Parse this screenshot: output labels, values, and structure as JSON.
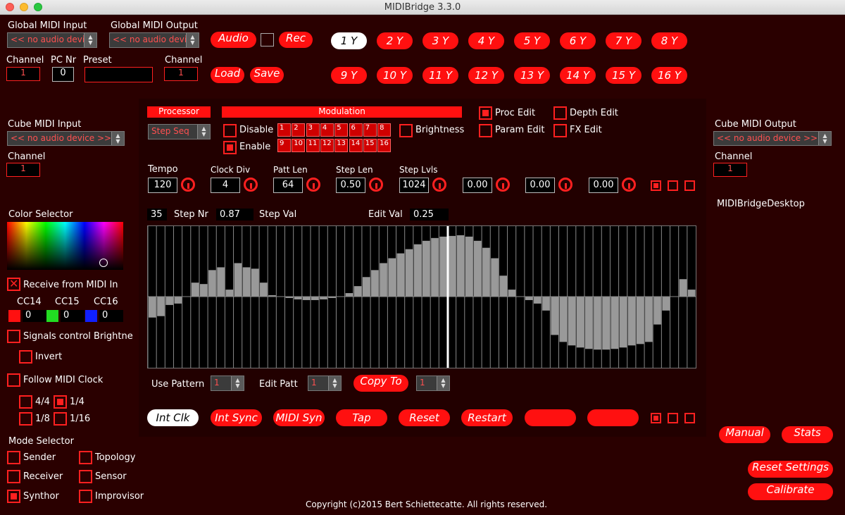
{
  "window": {
    "title": "MIDIBridge 3.3.0"
  },
  "global": {
    "midi_input_label": "Global MIDI Input",
    "midi_input_value": "<< no audio devic...",
    "midi_output_label": "Global MIDI Output",
    "midi_output_value": "<< no audio devic...",
    "channel_label": "Channel",
    "channel_value": "1",
    "pc_label": "PC Nr",
    "pc_value": "0",
    "preset_label": "Preset",
    "preset_value": "",
    "out_channel_label": "Channel",
    "out_channel_value": "1"
  },
  "top_buttons": {
    "audio": "Audio",
    "rec": "Rec",
    "load": "Load",
    "save": "Save"
  },
  "patterns": [
    "1 Y",
    "2 Y",
    "3 Y",
    "4 Y",
    "5 Y",
    "6 Y",
    "7 Y",
    "8 Y",
    "9 Y",
    "10 Y",
    "11 Y",
    "12 Y",
    "13 Y",
    "14 Y",
    "15 Y",
    "16 Y"
  ],
  "cube_in": {
    "label": "Cube MIDI Input",
    "value": "<< no audio device >>",
    "channel_label": "Channel",
    "channel_value": "1"
  },
  "cube_out": {
    "label": "Cube MIDI Output",
    "value": "<< no audio device >>",
    "channel_label": "Channel",
    "channel_value": "1",
    "desktop": "MIDIBridgeDesktop"
  },
  "processor": {
    "label": "Processor",
    "value": "Step Seq"
  },
  "modulation": {
    "label": "Modulation",
    "disable": "Disable",
    "enable": "Enable",
    "brightness": "Brightness",
    "row1": [
      "1",
      "2",
      "3",
      "4",
      "5",
      "6",
      "7",
      "8"
    ],
    "row2": [
      "9",
      "10",
      "11",
      "12",
      "13",
      "14",
      "15",
      "16"
    ]
  },
  "edit": {
    "proc": "Proc Edit",
    "param": "Param Edit",
    "depth": "Depth Edit",
    "fx": "FX Edit"
  },
  "params": [
    {
      "label": "Tempo",
      "value": "120"
    },
    {
      "label": "Clock Div",
      "value": "4"
    },
    {
      "label": "Patt Len",
      "value": "64"
    },
    {
      "label": "Step Len",
      "value": "0.50"
    },
    {
      "label": "Step Lvls",
      "value": "1024"
    },
    {
      "label": "",
      "value": "0.00"
    },
    {
      "label": "",
      "value": "0.00"
    },
    {
      "label": "",
      "value": "0.00"
    }
  ],
  "step_info": {
    "step_nr": "35",
    "step_nr_label": "Step Nr",
    "step_val": "0.87",
    "step_val_label": "Step Val",
    "edit_val_label": "Edit Val",
    "edit_val": "0.25"
  },
  "chart_data": {
    "type": "bar",
    "selected_index": 35,
    "ylim": [
      -1,
      1
    ],
    "values": [
      -0.3,
      -0.28,
      -0.12,
      -0.1,
      0,
      0.2,
      0.18,
      0.38,
      0.42,
      0.1,
      0.48,
      0.42,
      0.4,
      0.2,
      0.02,
      0,
      -0.02,
      -0.04,
      -0.05,
      -0.05,
      -0.04,
      -0.02,
      0,
      0.05,
      0.15,
      0.28,
      0.38,
      0.48,
      0.55,
      0.62,
      0.68,
      0.75,
      0.8,
      0.84,
      0.86,
      0.87,
      0.88,
      0.86,
      0.8,
      0.7,
      0.55,
      0.3,
      0.1,
      0,
      -0.05,
      -0.1,
      -0.2,
      -0.55,
      -0.65,
      -0.7,
      -0.73,
      -0.75,
      -0.76,
      -0.76,
      -0.75,
      -0.73,
      -0.7,
      -0.68,
      -0.65,
      -0.4,
      -0.2,
      0,
      0.25,
      0.1
    ]
  },
  "pattern_ctrl": {
    "use_label": "Use Pattern",
    "use_value": "1",
    "edit_label": "Edit Patt",
    "edit_value": "1",
    "copy_label": "Copy To",
    "copy_value": "1"
  },
  "clock_buttons": [
    "Int Clk",
    "Int Sync",
    "MIDI Syn",
    "Tap",
    "Reset",
    "Restart",
    "",
    ""
  ],
  "color": {
    "label": "Color Selector",
    "receive": "Receive from MIDI In",
    "cc": [
      {
        "label": "CC14",
        "value": "0",
        "color": "#ff1010"
      },
      {
        "label": "CC15",
        "value": "0",
        "color": "#22dd22"
      },
      {
        "label": "CC16",
        "value": "0",
        "color": "#1020ff"
      }
    ],
    "signals": "Signals control Brightne",
    "invert": "Invert",
    "follow": "Follow MIDI Clock",
    "div": [
      "4/4",
      "1/4",
      "1/8",
      "1/16"
    ]
  },
  "mode": {
    "label": "Mode Selector",
    "items": [
      "Sender",
      "Topology",
      "Receiver",
      "Sensor",
      "Synthor",
      "Improvisor"
    ]
  },
  "right_buttons": {
    "manual": "Manual",
    "stats": "Stats",
    "reset_settings": "Reset Settings",
    "calibrate": "Calibrate"
  },
  "footer": "Copyright (c)2015 Bert Schiettecatte. All rights reserved."
}
